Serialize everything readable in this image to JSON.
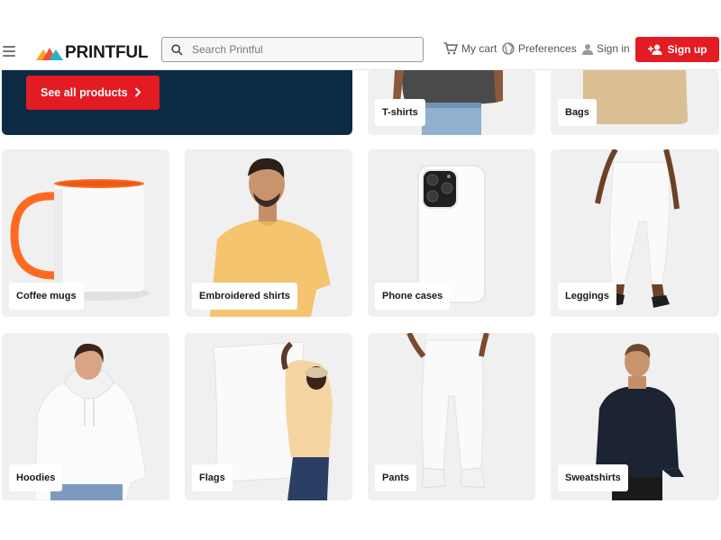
{
  "header": {
    "logo_text": "PRINTFUL",
    "search_placeholder": "Search Printful",
    "cart_label": "My cart",
    "preferences_label": "Preferences",
    "signin_label": "Sign in",
    "signup_label": "Sign up",
    "colors": {
      "accent": "#e31b23",
      "hero_bg": "#0c2a44"
    }
  },
  "hero": {
    "button_label": "See all products"
  },
  "products": [
    {
      "label": "T-shirts"
    },
    {
      "label": "Bags"
    },
    {
      "label": "Coffee mugs"
    },
    {
      "label": "Embroidered shirts"
    },
    {
      "label": "Phone cases"
    },
    {
      "label": "Leggings"
    },
    {
      "label": "Hoodies"
    },
    {
      "label": "Flags"
    },
    {
      "label": "Pants"
    },
    {
      "label": "Sweatshirts"
    }
  ]
}
